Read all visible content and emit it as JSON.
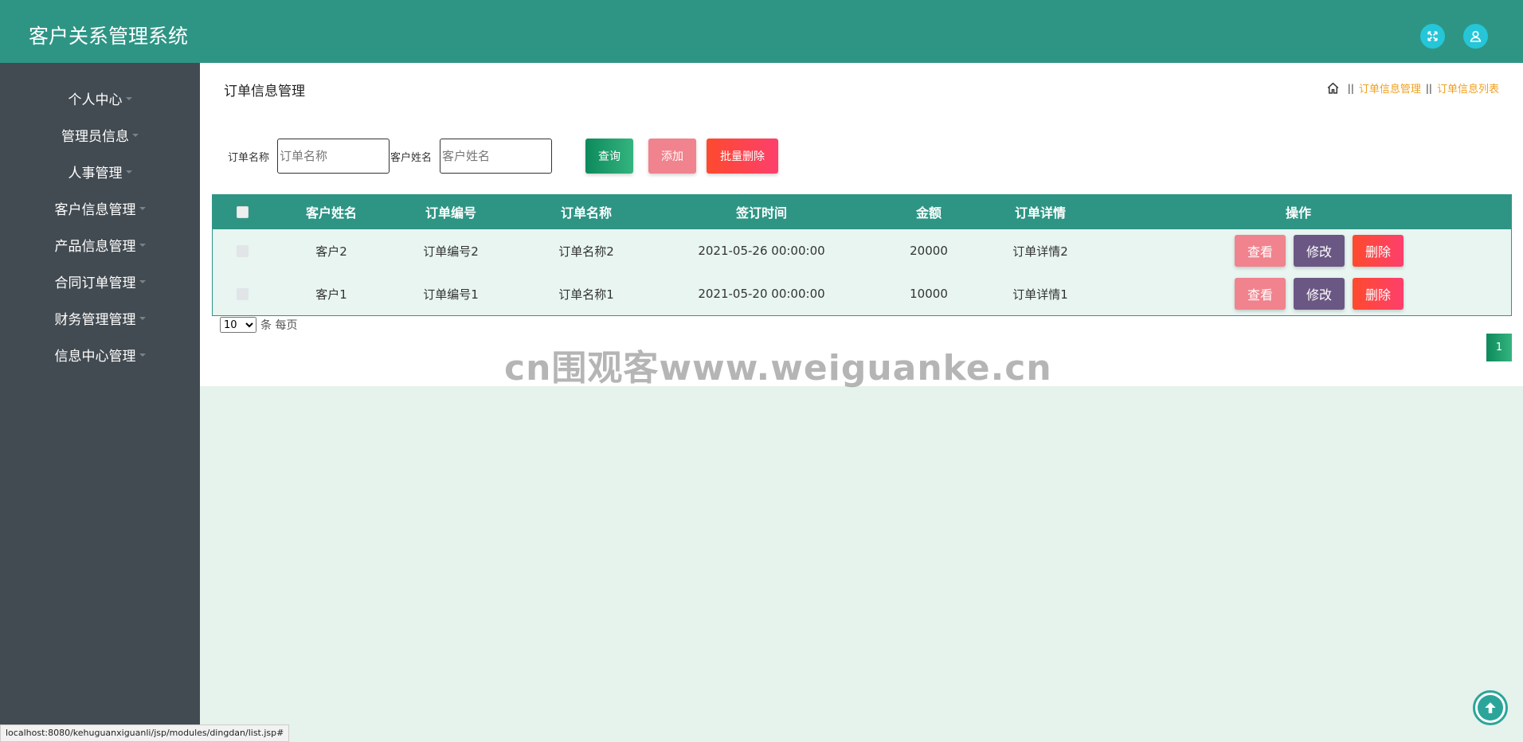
{
  "header": {
    "title": "客户关系管理系统"
  },
  "sidebar": {
    "items": [
      {
        "label": "个人中心"
      },
      {
        "label": "管理员信息"
      },
      {
        "label": "人事管理"
      },
      {
        "label": "客户信息管理"
      },
      {
        "label": "产品信息管理"
      },
      {
        "label": "合同订单管理"
      },
      {
        "label": "财务管理管理"
      },
      {
        "label": "信息中心管理"
      }
    ]
  },
  "page": {
    "title": "订单信息管理",
    "breadcrumb": {
      "sep": "||",
      "items": [
        "订单信息管理",
        "订单信息列表"
      ]
    }
  },
  "search": {
    "order_name_label": "订单名称",
    "order_name_placeholder": "订单名称",
    "customer_name_label": "客户姓名",
    "customer_name_placeholder": "客户姓名",
    "query_label": "查询",
    "add_label": "添加",
    "batch_delete_label": "批量删除"
  },
  "table": {
    "headers": [
      "客户姓名",
      "订单编号",
      "订单名称",
      "签订时间",
      "金额",
      "订单详情",
      "操作"
    ],
    "rows": [
      {
        "customer": "客户2",
        "order_no": "订单编号2",
        "order_name": "订单名称2",
        "signed_at": "2021-05-26 00:00:00",
        "amount": "20000",
        "detail": "订单详情2"
      },
      {
        "customer": "客户1",
        "order_no": "订单编号1",
        "order_name": "订单名称1",
        "signed_at": "2021-05-20 00:00:00",
        "amount": "10000",
        "detail": "订单详情1"
      }
    ],
    "actions": {
      "view": "查看",
      "edit": "修改",
      "delete": "删除"
    }
  },
  "pagination": {
    "page_size": "10",
    "per_page_label": "条 每页",
    "current_page": "1"
  },
  "watermark": "cn围观客www.weiguanke.cn",
  "status_url": "localhost:8080/kehuguanxiguanli/jsp/modules/dingdan/list.jsp#"
}
